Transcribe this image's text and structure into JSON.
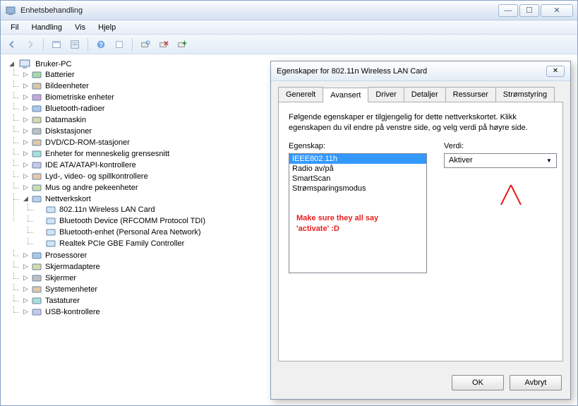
{
  "window": {
    "title": "Enhetsbehandling",
    "controls": {
      "min": "—",
      "max": "☐",
      "close": "✕"
    }
  },
  "menu": {
    "items": [
      "Fil",
      "Handling",
      "Vis",
      "Hjelp"
    ]
  },
  "tree": {
    "root": "Bruker-PC",
    "categories": [
      "Batterier",
      "Bildeenheter",
      "Biometriske enheter",
      "Bluetooth-radioer",
      "Datamaskin",
      "Diskstasjoner",
      "DVD/CD-ROM-stasjoner",
      "Enheter for menneskelig grensesnitt",
      "IDE ATA/ATAPI-kontrollere",
      "Lyd-, video- og spillkontrollere",
      "Mus og andre pekeenheter"
    ],
    "network": {
      "label": "Nettverkskort",
      "children": [
        "802.11n Wireless LAN Card",
        "Bluetooth Device (RFCOMM Protocol TDI)",
        "Bluetooth-enhet (Personal Area Network)",
        "Realtek PCIe GBE Family Controller"
      ]
    },
    "categories2": [
      "Prosessorer",
      "Skjermadaptere",
      "Skjermer",
      "Systemenheter",
      "Tastaturer",
      "USB-kontrollere"
    ]
  },
  "dialog": {
    "title": "Egenskaper for 802.11n Wireless LAN Card",
    "close_glyph": "✕",
    "tabs": [
      "Generelt",
      "Avansert",
      "Driver",
      "Detaljer",
      "Ressurser",
      "Strømstyring"
    ],
    "active_tab": 1,
    "description": "Følgende egenskaper er tilgjengelig for dette nettverkskortet. Klikk egenskapen du vil endre på venstre side, og velg verdi på høyre side.",
    "property_label": "Egenskap:",
    "value_label": "Verdi:",
    "properties": [
      "IEEE802.11h",
      "Radio av/på",
      "SmartScan",
      "Strømsparingsmodus"
    ],
    "selected_property": 0,
    "value": "Aktiver",
    "ok": "OK",
    "cancel": "Avbryt"
  },
  "annotation": {
    "line1": "Make sure they all say",
    "line2": "'activate' :D"
  }
}
